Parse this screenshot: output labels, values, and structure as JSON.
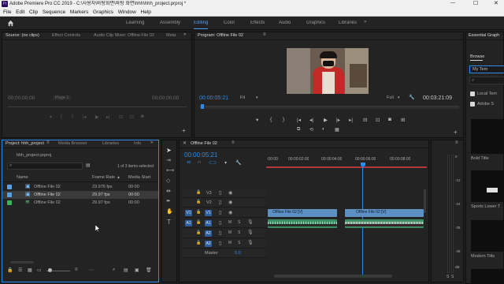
{
  "titlebar": {
    "title": "Adobe Premiere Pro CC 2019 - C:\\사용자\\바탕화면\\바탕 화면\\hhh\\hhh_project.prproj *",
    "minimize": "—",
    "maximize": "☐",
    "close": "✕"
  },
  "menubar": {
    "items": [
      "File",
      "Edit",
      "Clip",
      "Sequence",
      "Markers",
      "Graphics",
      "Window",
      "Help"
    ]
  },
  "workspaces": {
    "items": [
      "Learning",
      "Assembly",
      "Editing",
      "Color",
      "Effects",
      "Audio",
      "Graphics",
      "Libraries"
    ],
    "active": "Editing"
  },
  "source_panel": {
    "tabs": [
      "Source: (no clips)",
      "Effect Controls",
      "Audio Clip Mixer: Offline File 02",
      "Meta"
    ],
    "timecode_left": "00;00;00;00",
    "page": "Page 1",
    "timecode_right": "00;00;00;00"
  },
  "program_panel": {
    "tab": "Program: Offline File 02",
    "timecode": "00:00:05:21",
    "fit": "Fit",
    "quality": "Full",
    "duration": "00:03:21:09"
  },
  "essential_graphics": {
    "tab": "Essential Graph",
    "browse": "Browse",
    "my_templates": "My Tem",
    "local_templates": "Local Tem",
    "adobe_stock": "Adobe S",
    "templates": [
      "Bold Title",
      "Sports Lower T",
      "Modern Title"
    ]
  },
  "project_panel": {
    "tabs": [
      "Project: hhh_project",
      "Media Browser",
      "Libraries",
      "Info"
    ],
    "file_name": "hhh_project.prproj",
    "selected_count": "1 of 3 items selected",
    "columns": [
      "Name",
      "Frame Rate",
      "Media Start"
    ],
    "rows": [
      {
        "name": "Offline File 02",
        "frame_rate": "23.976 fps",
        "media_start": "00:00",
        "color": "#5aa0e0"
      },
      {
        "name": "Offline File 02",
        "frame_rate": "29.97 fps",
        "media_start": "00:00",
        "color": "#5aa0e0"
      },
      {
        "name": "Offline File 02",
        "frame_rate": "29.97 fps",
        "media_start": "00:00",
        "color": "#3cb35a"
      }
    ]
  },
  "timeline_panel": {
    "tab": "Offline File 02",
    "timecode": "00:00:05:21",
    "ruler": [
      ":00:00",
      "00:00:02:00",
      "00:00:04:00",
      "00:00:06:00",
      "00:00:08:00"
    ],
    "video_tracks": [
      "V3",
      "V2",
      "V1"
    ],
    "audio_tracks": [
      "A1",
      "A2",
      "A3"
    ],
    "source_v": "V1",
    "source_a": "A1",
    "master_label": "Master",
    "master_value": "0.0",
    "clip_v1_a": "Offline File 02 [V]",
    "clip_v1_b": "Offline File 02 [V]"
  },
  "audio_meter": {
    "scale": [
      "0",
      "-12",
      "-24",
      "-36",
      "-48",
      "dB"
    ],
    "solo": "S",
    "solo2": "S"
  }
}
